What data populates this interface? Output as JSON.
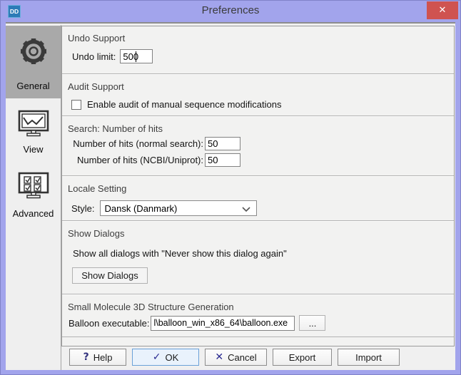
{
  "window": {
    "title": "Preferences",
    "app_icon_text": "DD",
    "close_glyph": "✕"
  },
  "sidebar": {
    "items": [
      {
        "label": "General",
        "icon": "gear-icon",
        "selected": true
      },
      {
        "label": "View",
        "icon": "monitor-chart-icon",
        "selected": false
      },
      {
        "label": "Advanced",
        "icon": "monitor-checkboxes-icon",
        "selected": false
      }
    ]
  },
  "sections": {
    "undo": {
      "heading": "Undo Support",
      "limit_label": "Undo limit:",
      "limit_value": "500"
    },
    "audit": {
      "heading": "Audit Support",
      "checkbox_label": "Enable audit of manual sequence modifications",
      "checked": false
    },
    "search": {
      "heading": "Search: Number of hits",
      "rows": [
        {
          "label": "Number of hits (normal search):",
          "value": "50"
        },
        {
          "label": "Number of hits (NCBI/Uniprot):",
          "value": "50"
        }
      ]
    },
    "locale": {
      "heading": "Locale Setting",
      "style_label": "Style:",
      "style_value": "Dansk (Danmark)"
    },
    "dialogs": {
      "heading": "Show Dialogs",
      "description": "Show all dialogs with \"Never show this dialog again\"",
      "button_label": "Show Dialogs"
    },
    "molecule": {
      "heading": "Small Molecule 3D Structure Generation",
      "exe_label": "Balloon executable:",
      "exe_value": "l\\balloon_win_x86_64\\balloon.exe",
      "browse_label": "..."
    }
  },
  "footer": {
    "buttons": [
      {
        "label": "Help",
        "icon": "?"
      },
      {
        "label": "OK",
        "icon": "✓",
        "default": true
      },
      {
        "label": "Cancel",
        "icon": "✕"
      },
      {
        "label": "Export"
      },
      {
        "label": "Import"
      }
    ]
  },
  "colors": {
    "titlebar": "#a2a4ec",
    "close_button": "#cf5350",
    "app_icon": "#2d7bb7",
    "selected_sidebar_item": "#a9a9a9",
    "ok_button_border": "#6aa1d8",
    "ok_button_bg": "#e9f2fc",
    "panel_bg": "#f2f2f1"
  }
}
